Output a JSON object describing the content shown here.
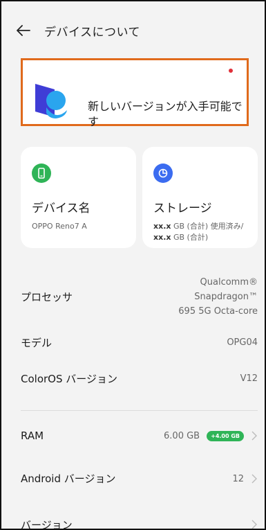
{
  "header": {
    "title": "デバイスについて",
    "back_icon": "back-arrow-icon"
  },
  "update_banner": {
    "text": "新しいバージョンが入手可能です"
  },
  "cards": {
    "device": {
      "title": "デバイス名",
      "subtitle": "OPPO Reno7 A",
      "icon": "phone-icon",
      "color": "#2fb457"
    },
    "storage": {
      "title": "ストレージ",
      "line1_bold": "xx.x",
      "line1": " GB (合計) 使用済み/",
      "line2_bold": "xx.x",
      "line2": " GB (合計)",
      "icon": "pie-chart-icon",
      "color": "#3b6cf0"
    }
  },
  "info": {
    "processor": {
      "label": "プロセッサ",
      "value_lines": [
        "Qualcomm®",
        "Snapdragon™",
        "695 5G Octa-core"
      ]
    },
    "model": {
      "label": "モデル",
      "value": "OPG04"
    },
    "coloros": {
      "label": "ColorOS バージョン",
      "value": "V12"
    },
    "ram": {
      "label": "RAM",
      "value": "6.00 GB",
      "badge": "+4.00 GB"
    },
    "android": {
      "label": "Android バージョン",
      "value": "12"
    },
    "version": {
      "label": "バージョン",
      "value": ""
    }
  },
  "colors": {
    "accent_green": "#2fb457",
    "accent_blue": "#3b6cf0",
    "highlight_border": "#e06a1c"
  }
}
